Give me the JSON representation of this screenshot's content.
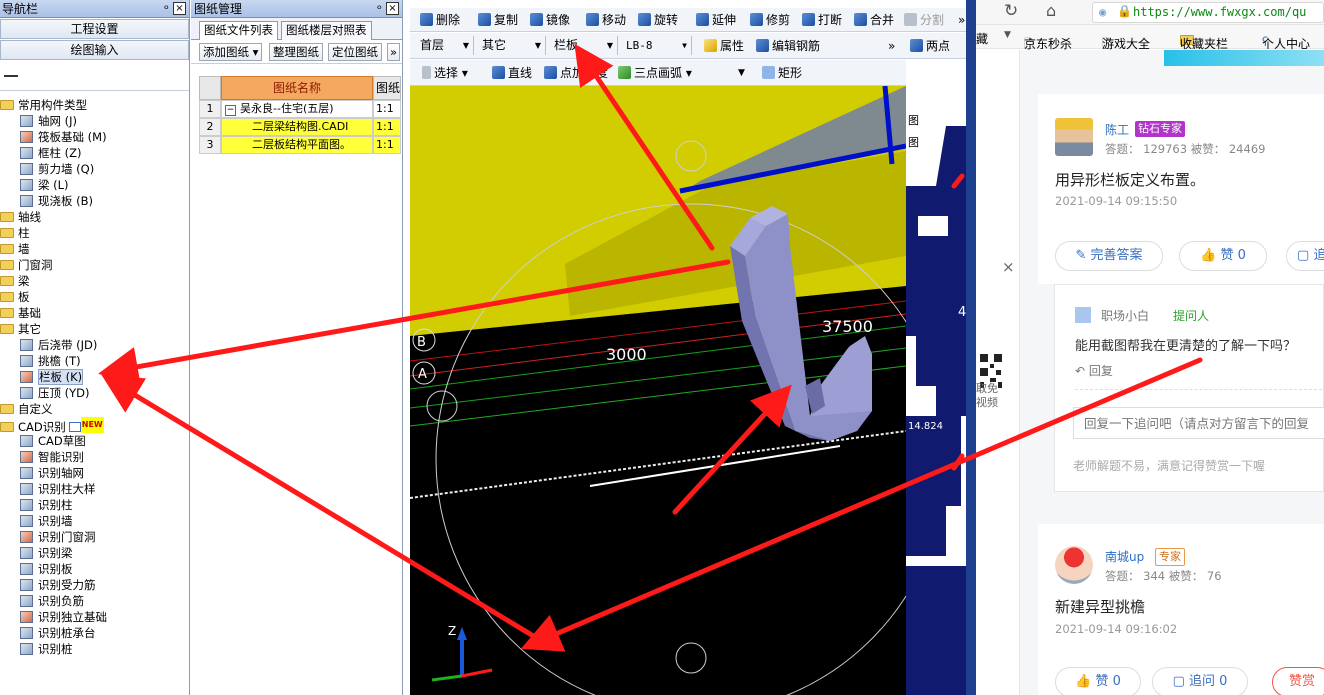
{
  "nav": {
    "title": "导航栏",
    "pin": "ᵒ",
    "close": "×",
    "btn_project": "工程设置",
    "btn_draw": "绘图输入",
    "tree": [
      {
        "type": "folder",
        "label": "常用构件类型",
        "indent": 0
      },
      {
        "type": "item",
        "label": "轴网 (J)",
        "indent": 1
      },
      {
        "type": "item",
        "label": "筏板基础 (M)",
        "indent": 1
      },
      {
        "type": "item",
        "label": "框柱 (Z)",
        "indent": 1
      },
      {
        "type": "item",
        "label": "剪力墙 (Q)",
        "indent": 1
      },
      {
        "type": "item",
        "label": "梁 (L)",
        "indent": 1
      },
      {
        "type": "item",
        "label": "现浇板 (B)",
        "indent": 1
      },
      {
        "type": "folder",
        "label": "轴线",
        "indent": 0
      },
      {
        "type": "folder",
        "label": "柱",
        "indent": 0
      },
      {
        "type": "folder",
        "label": "墙",
        "indent": 0
      },
      {
        "type": "folder",
        "label": "门窗洞",
        "indent": 0
      },
      {
        "type": "folder",
        "label": "梁",
        "indent": 0
      },
      {
        "type": "folder",
        "label": "板",
        "indent": 0
      },
      {
        "type": "folder",
        "label": "基础",
        "indent": 0
      },
      {
        "type": "folder",
        "label": "其它",
        "indent": 0
      },
      {
        "type": "item",
        "label": "后浇带 (JD)",
        "indent": 1
      },
      {
        "type": "item",
        "label": "挑檐 (T)",
        "indent": 1
      },
      {
        "type": "item",
        "label": "栏板 (K)",
        "indent": 1,
        "selected": true
      },
      {
        "type": "item",
        "label": "压顶 (YD)",
        "indent": 1
      },
      {
        "type": "folder",
        "label": "自定义",
        "indent": 0
      },
      {
        "type": "folder",
        "label": "CAD识别",
        "indent": 0,
        "badge": "NEW"
      },
      {
        "type": "item",
        "label": "CAD草图",
        "indent": 1
      },
      {
        "type": "item",
        "label": "智能识别",
        "indent": 1
      },
      {
        "type": "item",
        "label": "识别轴网",
        "indent": 1
      },
      {
        "type": "item",
        "label": "识别柱大样",
        "indent": 1
      },
      {
        "type": "item",
        "label": "识别柱",
        "indent": 1
      },
      {
        "type": "item",
        "label": "识别墙",
        "indent": 1
      },
      {
        "type": "item",
        "label": "识别门窗洞",
        "indent": 1
      },
      {
        "type": "item",
        "label": "识别梁",
        "indent": 1
      },
      {
        "type": "item",
        "label": "识别板",
        "indent": 1
      },
      {
        "type": "item",
        "label": "识别受力筋",
        "indent": 1
      },
      {
        "type": "item",
        "label": "识别负筋",
        "indent": 1
      },
      {
        "type": "item",
        "label": "识别独立基础",
        "indent": 1
      },
      {
        "type": "item",
        "label": "识别桩承台",
        "indent": 1
      },
      {
        "type": "item",
        "label": "识别桩",
        "indent": 1
      }
    ]
  },
  "dm": {
    "title": "图纸管理",
    "pin": "ᵒ",
    "close": "×",
    "tab_files": "图纸文件列表",
    "tab_floors": "图纸楼层对照表",
    "btn_add": "添加图纸",
    "btn_sort": "整理图纸",
    "btn_locate": "定位图纸",
    "more": "»",
    "col_name": "图纸名称",
    "col_scale": "图纸",
    "rows": [
      {
        "no": "1",
        "name": "吴永良--住宅(五层)",
        "scale": "1:1",
        "expander": "−"
      },
      {
        "no": "2",
        "name": "二层梁结构图.CADI",
        "scale": "1:1"
      },
      {
        "no": "3",
        "name": "二层板结构平面图。",
        "scale": "1:1"
      }
    ]
  },
  "toolbar1": {
    "delete": "删除",
    "copy": "复制",
    "mirror": "镜像",
    "move": "移动",
    "rotate": "旋转",
    "extend": "延伸",
    "trim": "修剪",
    "break": "打断",
    "merge": "合并",
    "split": "分割",
    "more": "»"
  },
  "toolbar2": {
    "floor": "首层",
    "category": "其它",
    "component": "栏板",
    "name": "LB-8",
    "props": "属性",
    "edit_rebar": "编辑钢筋",
    "more": "»",
    "two_points": "两点"
  },
  "toolbar3": {
    "select": "选择",
    "line": "直线",
    "point_length": "点加长度",
    "arc3": "三点画弧",
    "rect": "矩形"
  },
  "viewport": {
    "dim1": "3000",
    "dim2": "37500",
    "axis_b": "B",
    "axis_a": "A",
    "axis_z": "Z",
    "strip_text1": "图",
    "strip_text2": "图",
    "strip_value": "14.824",
    "strip_prefix": "4"
  },
  "browser": {
    "url": "https://www.fwxgx.com/qu",
    "bookmarks": [
      "藏",
      "京东秒杀",
      "游戏大全",
      "收藏夹栏",
      "个人中心"
    ],
    "close_ad": "×",
    "qr_text": "取免\n视频",
    "answers": [
      {
        "user": "陈工",
        "badge": "钻石专家",
        "stats": "答题： 129763    被赞： 24469",
        "text": "用异形栏板定义布置。",
        "time": "2021-09-14 09:15:50",
        "btn_improve": "完善答案",
        "btn_like": "赞 0",
        "btn_ask": "追问"
      },
      {
        "user": "南城up",
        "badge": "专家",
        "stats": "答题： 344    被赞： 76",
        "text": "新建异型挑檐",
        "time": "2021-09-14 09:16:02",
        "btn_like": "赞 0",
        "btn_ask": "追问 0",
        "btn_reward": "赞赏"
      }
    ],
    "followup": {
      "user": "职场小白",
      "role": "提问人",
      "text": "能用截图帮我在更清楚的了解一下吗？",
      "reply": "回复",
      "input_placeholder": "回复一下追问吧（请点对方留言下的回复",
      "hint": "老师解题不易，满意记得赞赏一下喔"
    }
  },
  "colors": {
    "yellow_plane": "#cfcc00",
    "component": "#8d8fc7",
    "annotation": "#ff1a1a",
    "nav_header": "#a9c1e6"
  }
}
